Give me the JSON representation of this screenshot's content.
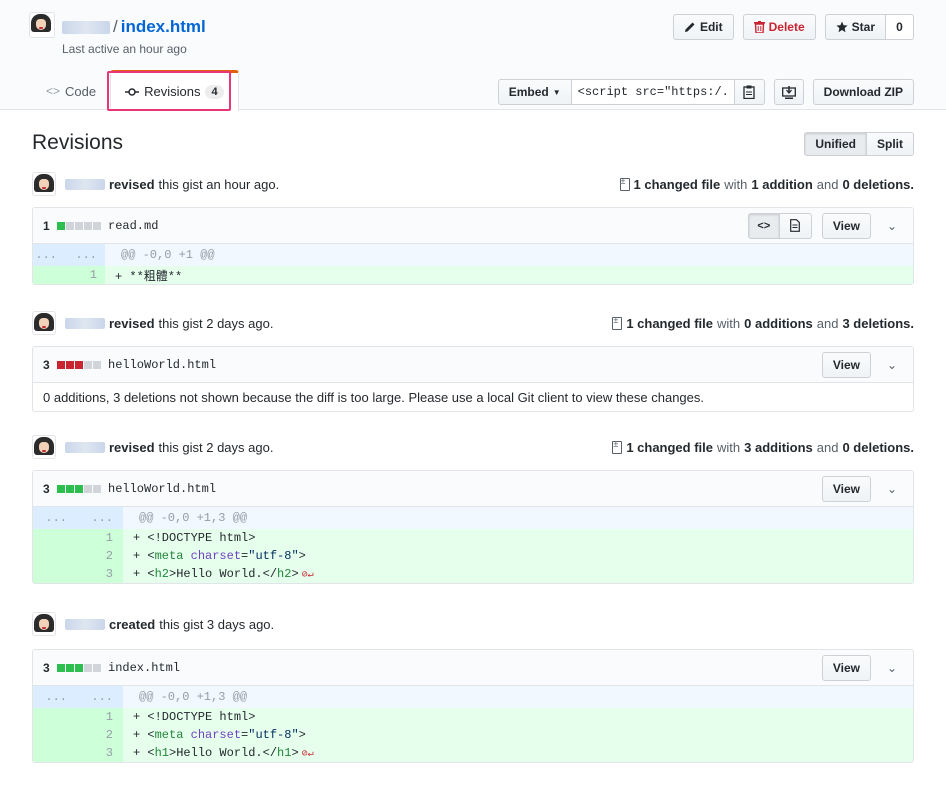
{
  "header": {
    "separator": "/",
    "file_name": "index.html",
    "last_active": "Last active an hour ago",
    "edit_label": "Edit",
    "delete_label": "Delete",
    "star_label": "Star",
    "star_count": "0"
  },
  "tabs": {
    "code_label": "Code",
    "revisions_label": "Revisions",
    "revisions_count": "4"
  },
  "embed": {
    "label": "Embed",
    "value": "<script src=\"https:/.",
    "download_label": "Download ZIP"
  },
  "main": {
    "title": "Revisions",
    "unified_label": "Unified",
    "split_label": "Split"
  },
  "revisions": [
    {
      "action": "revised",
      "when": "this gist an hour ago.",
      "changed": "1 changed file",
      "with": "with",
      "additions": "1 addition",
      "and": "and",
      "deletions": "0 deletions.",
      "file": {
        "count": "1",
        "name": "read.md",
        "view_label": "View",
        "hunk_old": "...",
        "hunk_new": "...",
        "hunk": "@@ -0,0 +1 @@",
        "lines": [
          {
            "num": "1",
            "text": "+ **粗體**"
          }
        ]
      }
    },
    {
      "action": "revised",
      "when": "this gist 2 days ago.",
      "changed": "1 changed file",
      "with": "with",
      "additions": "0 additions",
      "and": "and",
      "deletions": "3 deletions.",
      "file": {
        "count": "3",
        "name": "helloWorld.html",
        "view_label": "View",
        "message": "0 additions, 3 deletions not shown because the diff is too large. Please use a local Git client to view these changes."
      }
    },
    {
      "action": "revised",
      "when": "this gist 2 days ago.",
      "changed": "1 changed file",
      "with": "with",
      "additions": "3 additions",
      "and": "and",
      "deletions": "0 deletions.",
      "file": {
        "count": "3",
        "name": "helloWorld.html",
        "view_label": "View",
        "hunk_old": "...",
        "hunk_new": "...",
        "hunk": "@@ -0,0 +1,3 @@",
        "lines": [
          {
            "num": "1",
            "prefix": "+ <!DOCTYPE html>"
          },
          {
            "num": "2",
            "prefix": "+ <",
            "tag": "meta",
            "attr": "charset",
            "eq": "=",
            "str": "\"utf-8\"",
            "end": ">"
          },
          {
            "num": "3",
            "prefix": "+ <",
            "tag": "h2",
            "mid": ">Hello World.</",
            "tag2": "h2",
            "end": ">"
          }
        ]
      }
    },
    {
      "action": "created",
      "when": "this gist 3 days ago.",
      "file": {
        "count": "3",
        "name": "index.html",
        "view_label": "View",
        "hunk_old": "...",
        "hunk_new": "...",
        "hunk": "@@ -0,0 +1,3 @@",
        "lines": [
          {
            "num": "1",
            "prefix": "+ <!DOCTYPE html>"
          },
          {
            "num": "2",
            "prefix": "+ <",
            "tag": "meta",
            "attr": "charset",
            "eq": "=",
            "str": "\"utf-8\"",
            "end": ">"
          },
          {
            "num": "3",
            "prefix": "+ <",
            "tag": "h1",
            "mid": ">Hello World.</",
            "tag2": "h1",
            "end": ">"
          }
        ]
      }
    }
  ],
  "colors": {
    "link": "#0366d6",
    "danger": "#cb2431",
    "addition": "#2cbe4e",
    "highlight": "#e7367a"
  },
  "icons": [
    "pencil-icon",
    "trash-icon",
    "star-icon",
    "code-icon",
    "commit-icon",
    "clipboard-icon",
    "desktop-download-icon",
    "file-diff-icon",
    "file-text-icon",
    "chevron-down-icon",
    "no-newline-icon"
  ]
}
